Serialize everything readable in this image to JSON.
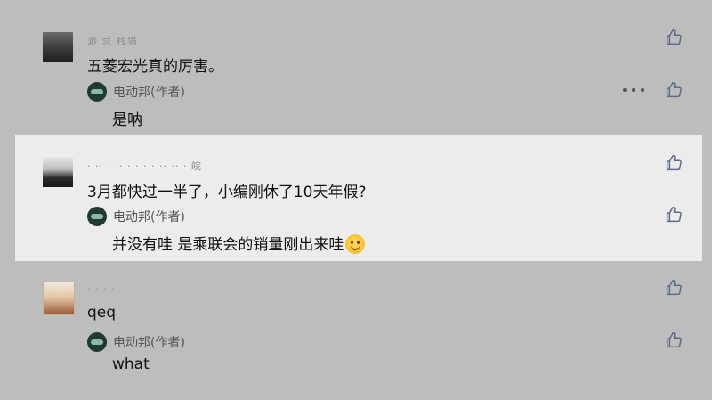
{
  "colors": {
    "background": "#bdbdbd",
    "highlight": "#ececec",
    "like_icon": "#5d6a86"
  },
  "comments": [
    {
      "username": "渺 忌 栈猫",
      "text": "五菱宏光真的厉害。",
      "reply": {
        "author": "电动邦(作者)",
        "text": "是呐"
      }
    },
    {
      "username": "· ·· ·  ·· · ·  ·  ·  ·· ·· · 皖",
      "text": "3月都快过一半了，小编刚休了10天年假?",
      "reply": {
        "author": "电动邦(作者)",
        "text": "并没有哇 是乘联会的销量刚出来哇"
      }
    },
    {
      "username": "· · · ·",
      "text": "qeq",
      "reply": {
        "author": "电动邦(作者)",
        "text": "what"
      }
    }
  ],
  "icons": {
    "like": "thumbs-up-icon",
    "more": "more-horizontal-icon",
    "emoji": "smile-emoji-icon"
  }
}
